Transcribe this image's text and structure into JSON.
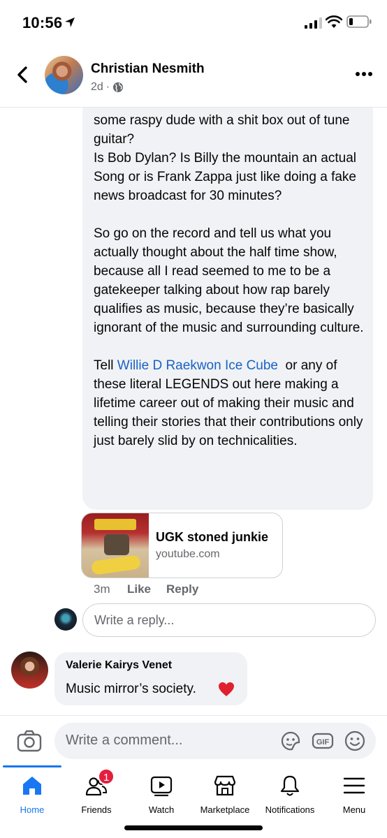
{
  "status_bar": {
    "time": "10:56"
  },
  "post_header": {
    "author": "Christian Nesmith",
    "age": "2d",
    "privacy_icon": "globe-icon"
  },
  "comment": {
    "paragraphs": [
      "some raspy dude with a shit box out of tune guitar?\nIs Bob Dylan?    Is Billy the mountain an actual\nSong or is Frank Zappa just like doing a fake news broadcast for 30 minutes?",
      "So go on the record and tell us what you actually thought about the half time show, because all I read seemed to me to be a gatekeeper talking about how rap barely qualifies as music, because they’re basically ignorant of the music and surrounding culture."
    ],
    "tell_prefix": "Tell ",
    "mentions": "Willie D Raekwon Ice Cube",
    "tell_suffix": "  or any of these literal LEGENDS out here making a lifetime career out of making their music and telling their stories that their contributions only just barely slid by on technicalities."
  },
  "link_preview": {
    "title": "UGK stoned junkie",
    "source": "youtube.com"
  },
  "comment_actions": {
    "time": "3m",
    "like": "Like",
    "reply": "Reply"
  },
  "reply_box": {
    "placeholder": "Write a reply..."
  },
  "reply_comment": {
    "author": "Valerie Kairys Venet",
    "text": "Music mirror’s society."
  },
  "composer": {
    "placeholder": "Write a comment...",
    "gif_label": "GIF"
  },
  "tabs": [
    {
      "label": "Home",
      "icon": "home-icon",
      "active": true
    },
    {
      "label": "Friends",
      "icon": "friends-icon",
      "badge": "1"
    },
    {
      "label": "Watch",
      "icon": "watch-icon"
    },
    {
      "label": "Marketplace",
      "icon": "marketplace-icon"
    },
    {
      "label": "Notifications",
      "icon": "bell-icon"
    },
    {
      "label": "Menu",
      "icon": "menu-icon"
    }
  ],
  "colors": {
    "accent": "#1877f2",
    "link": "#1a62c4",
    "badge": "#e41e3f",
    "bubble": "#f0f2f5"
  }
}
